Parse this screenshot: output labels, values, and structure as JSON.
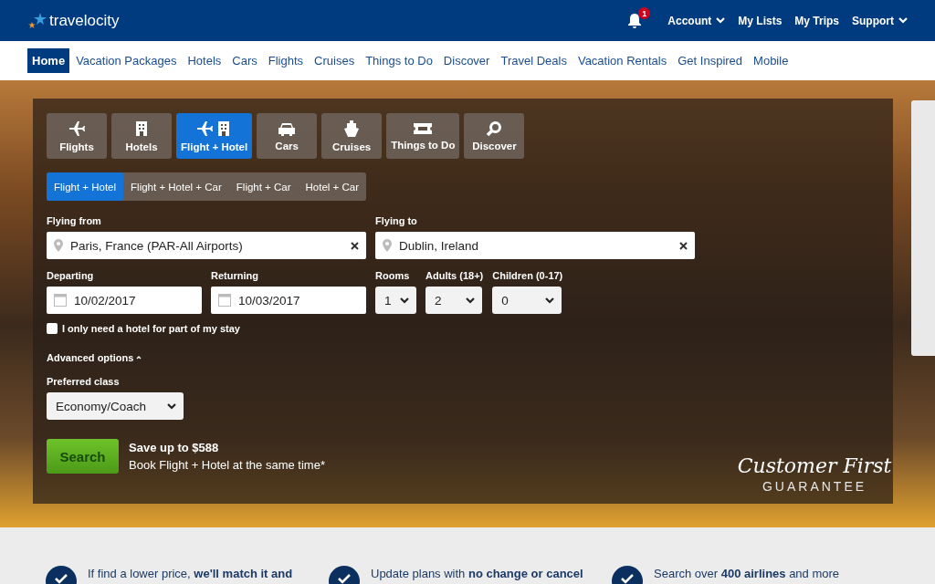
{
  "header": {
    "logo": "travelocity",
    "notification_count": "1",
    "links": [
      {
        "label": "Account",
        "dropdown": true
      },
      {
        "label": "My Lists",
        "dropdown": false
      },
      {
        "label": "My Trips",
        "dropdown": false
      },
      {
        "label": "Support",
        "dropdown": true
      }
    ]
  },
  "nav": [
    {
      "label": "Home",
      "selected": true
    },
    {
      "label": "Vacation Packages",
      "selected": false
    },
    {
      "label": "Hotels",
      "selected": false
    },
    {
      "label": "Cars",
      "selected": false
    },
    {
      "label": "Flights",
      "selected": false
    },
    {
      "label": "Cruises",
      "selected": false
    },
    {
      "label": "Things to Do",
      "selected": false
    },
    {
      "label": "Discover",
      "selected": false
    },
    {
      "label": "Travel Deals",
      "selected": false
    },
    {
      "label": "Vacation Rentals",
      "selected": false
    },
    {
      "label": "Get Inspired",
      "selected": false
    },
    {
      "label": "Mobile",
      "selected": false
    }
  ],
  "search_panel": {
    "product_tabs": [
      {
        "label": "Flights",
        "kind": "flight",
        "selected": false
      },
      {
        "label": "Hotels",
        "kind": "hotel",
        "selected": false
      },
      {
        "label": "Flight + Hotel",
        "kind": "flight_hotel",
        "selected": true
      },
      {
        "label": "Cars",
        "kind": "car",
        "selected": false
      },
      {
        "label": "Cruises",
        "kind": "cruise",
        "selected": false
      },
      {
        "label": "Things to Do",
        "kind": "ticket",
        "selected": false
      },
      {
        "label": "Discover",
        "kind": "discover",
        "selected": false
      }
    ],
    "package_tabs": [
      {
        "label": "Flight + Hotel",
        "selected": true
      },
      {
        "label": "Flight + Hotel + Car",
        "selected": false
      },
      {
        "label": "Flight + Car",
        "selected": false
      },
      {
        "label": "Hotel + Car",
        "selected": false
      }
    ],
    "flying_from": {
      "label": "Flying from",
      "value": "Paris, France (PAR-All Airports)"
    },
    "flying_to": {
      "label": "Flying to",
      "value": "Dublin, Ireland"
    },
    "departing": {
      "label": "Departing",
      "value": "10/02/2017"
    },
    "returning": {
      "label": "Returning",
      "value": "10/03/2017"
    },
    "rooms": {
      "label": "Rooms",
      "value": "1"
    },
    "adults": {
      "label": "Adults (18+)",
      "value": "2"
    },
    "children": {
      "label": "Children (0-17)",
      "value": "0"
    },
    "partial_stay": {
      "label": "I only need a hotel for part of my stay",
      "checked": false
    },
    "advanced_options": {
      "label": "Advanced options",
      "expanded": true
    },
    "preferred_class": {
      "label": "Preferred class",
      "value": "Economy/Coach"
    },
    "search_button": "Search",
    "promo": {
      "headline": "Save up to $588",
      "subtext": "Book Flight + Hotel at the same time*"
    }
  },
  "guarantee": {
    "line1": "Customer First",
    "line2": "GUARANTEE"
  },
  "benefits": [
    {
      "text": "If find a lower price, **we'll match it and**"
    },
    {
      "text": "Update plans with **no change or cancel**"
    },
    {
      "text": "Search over **400 airlines** and more"
    }
  ]
}
